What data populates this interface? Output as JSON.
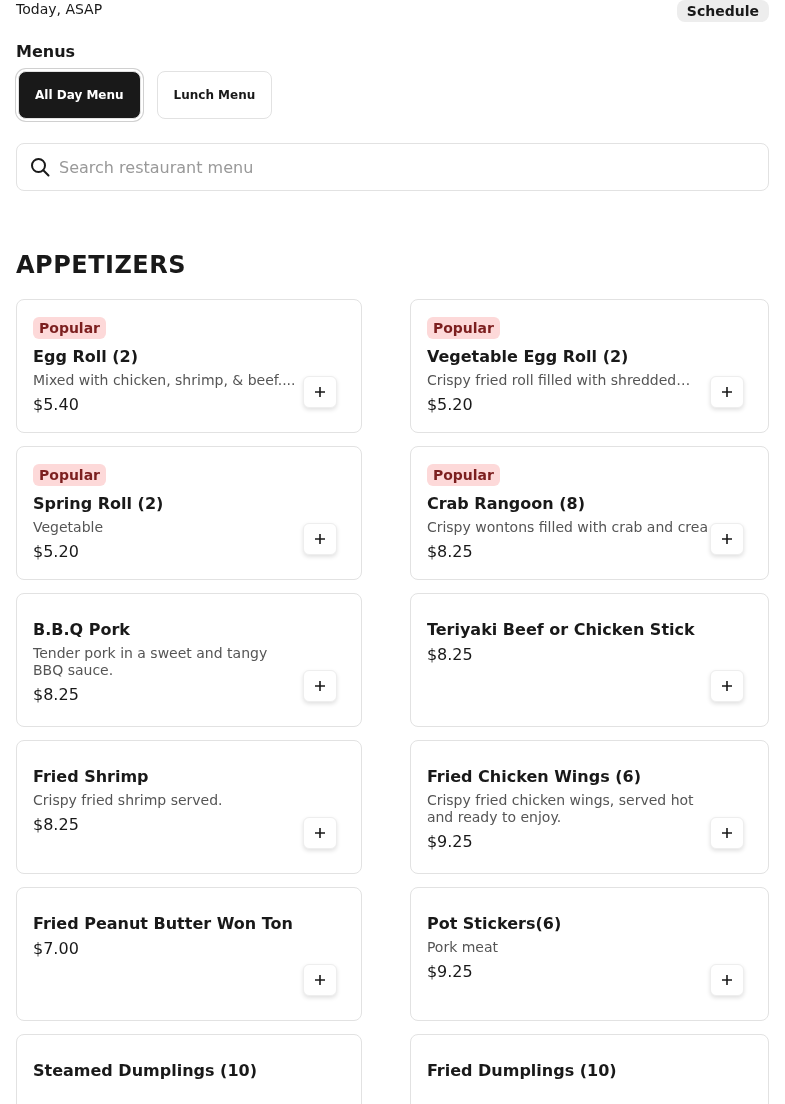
{
  "delivery": {
    "time": "Today, ASAP",
    "schedule_button": "Schedule"
  },
  "menus": {
    "title": "Menus",
    "tabs": [
      {
        "label": "All Day Menu",
        "selected": true
      },
      {
        "label": "Lunch Menu",
        "selected": false
      }
    ]
  },
  "search": {
    "placeholder": "Search restaurant menu"
  },
  "section": {
    "title": "APPETIZERS",
    "items": [
      {
        "badge": "Popular",
        "name": "Egg Roll (2)",
        "description": "Mixed with chicken, shrimp, & beef....",
        "price": "$5.40"
      },
      {
        "badge": "Popular",
        "name": "Vegetable Egg Roll (2)",
        "description": "Crispy fried roll filled with shredded…",
        "price": "$5.20"
      },
      {
        "badge": "Popular",
        "name": "Spring Roll (2)",
        "description": "Vegetable",
        "price": "$5.20"
      },
      {
        "badge": "Popular",
        "name": "Crab Rangoon (8)",
        "description": "Crispy wontons filled with crab and crea",
        "price": "$8.25"
      },
      {
        "name": "B.B.Q Pork",
        "description": "Tender pork in a sweet and tangy BBQ sauce.",
        "price": "$8.25"
      },
      {
        "name": "Teriyaki Beef or Chicken Stick",
        "price": "$8.25"
      },
      {
        "name": "Fried Shrimp",
        "description": "Crispy fried shrimp served.",
        "price": "$8.25"
      },
      {
        "name": "Fried Chicken Wings (6)",
        "description": "Crispy fried chicken wings, served hot and ready to enjoy.",
        "price": "$9.25"
      },
      {
        "name": "Fried Peanut Butter Won Ton",
        "price": "$7.00"
      },
      {
        "name": "Pot Stickers(6)",
        "description": "Pork meat",
        "price": "$9.25"
      },
      {
        "name": "Steamed Dumplings (10)"
      },
      {
        "name": "Fried Dumplings (10)"
      }
    ]
  }
}
